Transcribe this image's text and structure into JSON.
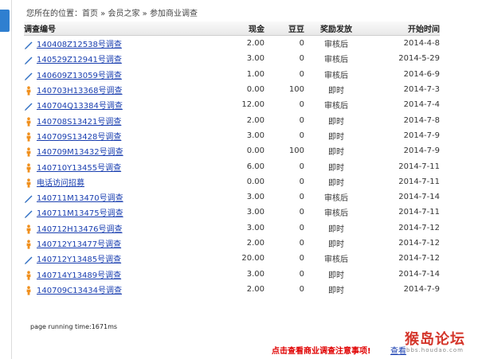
{
  "breadcrumb": {
    "prefix": "您所在的位置：",
    "home": "首页",
    "sep1": " » ",
    "members": "会员之家",
    "sep2": " » ",
    "current": "参加商业调查"
  },
  "table": {
    "headers": {
      "id": "调查编号",
      "cash": "现金",
      "score": "豆豆",
      "reward": "奖励发放",
      "date": "开始时间"
    },
    "rows": [
      {
        "icon": "pencil",
        "id": "140408Z12538号调查",
        "cash": "2.00",
        "score": "0",
        "reward": "审核后",
        "date": "2014-4-8"
      },
      {
        "icon": "pencil",
        "id": "140529Z12941号调查",
        "cash": "3.00",
        "score": "0",
        "reward": "审核后",
        "date": "2014-5-29"
      },
      {
        "icon": "pencil",
        "id": "140609Z13059号调查",
        "cash": "1.00",
        "score": "0",
        "reward": "审核后",
        "date": "2014-6-9"
      },
      {
        "icon": "person",
        "id": "140703H13368号调查",
        "cash": "0.00",
        "score": "100",
        "reward": "即时",
        "date": "2014-7-3"
      },
      {
        "icon": "pencil",
        "id": "140704Q13384号调查",
        "cash": "12.00",
        "score": "0",
        "reward": "审核后",
        "date": "2014-7-4"
      },
      {
        "icon": "person",
        "id": "140708S13421号调查",
        "cash": "2.00",
        "score": "0",
        "reward": "即时",
        "date": "2014-7-8"
      },
      {
        "icon": "person",
        "id": "140709S13428号调查",
        "cash": "3.00",
        "score": "0",
        "reward": "即时",
        "date": "2014-7-9"
      },
      {
        "icon": "person",
        "id": "140709M13432号调查",
        "cash": "0.00",
        "score": "100",
        "reward": "即时",
        "date": "2014-7-9"
      },
      {
        "icon": "person",
        "id": "140710Y13455号调查",
        "cash": "6.00",
        "score": "0",
        "reward": "即时",
        "date": "2014-7-11"
      },
      {
        "icon": "person",
        "id": "电话访问招募",
        "cash": "0.00",
        "score": "0",
        "reward": "即时",
        "date": "2014-7-11"
      },
      {
        "icon": "pencil",
        "id": "140711M13470号调查",
        "cash": "3.00",
        "score": "0",
        "reward": "审核后",
        "date": "2014-7-14"
      },
      {
        "icon": "pencil",
        "id": "140711M13475号调查",
        "cash": "3.00",
        "score": "0",
        "reward": "审核后",
        "date": "2014-7-11"
      },
      {
        "icon": "person",
        "id": "140712H13476号调查",
        "cash": "3.00",
        "score": "0",
        "reward": "即时",
        "date": "2014-7-12"
      },
      {
        "icon": "person",
        "id": "140712Y13477号调查",
        "cash": "2.00",
        "score": "0",
        "reward": "即时",
        "date": "2014-7-12"
      },
      {
        "icon": "pencil",
        "id": "140712Y13485号调查",
        "cash": "20.00",
        "score": "0",
        "reward": "审核后",
        "date": "2014-7-12"
      },
      {
        "icon": "person",
        "id": "140714Y13489号调查",
        "cash": "3.00",
        "score": "0",
        "reward": "即时",
        "date": "2014-7-14"
      },
      {
        "icon": "person",
        "id": "140709C13434号调查",
        "cash": "2.00",
        "score": "0",
        "reward": "即时",
        "date": "2014-7-9"
      }
    ]
  },
  "footer": {
    "runtime": "page running time:1671ms",
    "notice": "点击查看商业调查注意事项!",
    "notice2": "查看"
  },
  "watermark": {
    "text": "猴岛论坛",
    "url": "bbs.houdao.com"
  },
  "colors": {
    "link": "#1a3fb0",
    "notice": "#e00000",
    "pencil_icon": "#2e6fc4",
    "person_icon": "#f0901e",
    "sidebar_tab": "#2f7fd0"
  }
}
